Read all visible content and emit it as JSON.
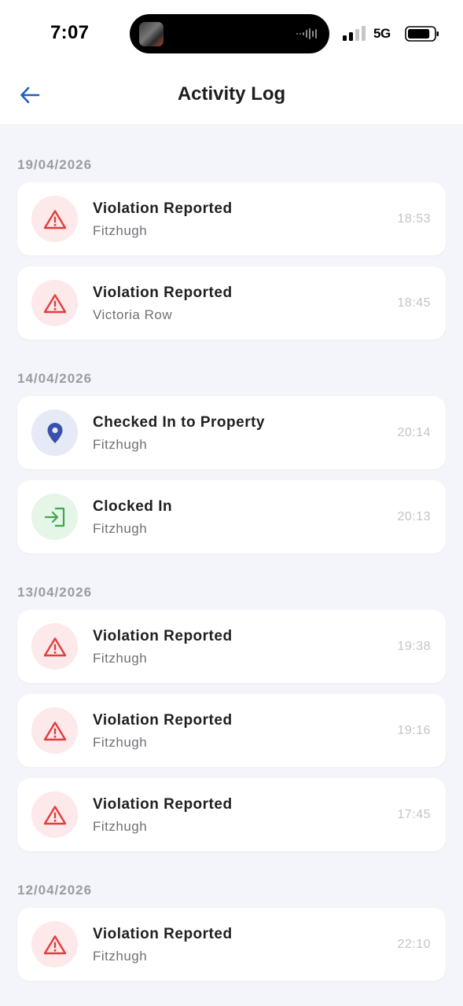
{
  "status_bar": {
    "time": "7:07",
    "network": "5G",
    "signal_bars_filled": 2,
    "signal_bars_total": 4,
    "battery_level": 0.85
  },
  "header": {
    "back_icon": "arrow-left-icon",
    "title": "Activity Log"
  },
  "colors": {
    "accent": "#1f5fbf",
    "violation": "#e23c3c",
    "checkin": "#3b4fad",
    "clockin": "#3fa84e"
  },
  "groups": [
    {
      "date": "19/04/2026",
      "entries": [
        {
          "type": "violation",
          "icon": "warning-icon",
          "title": "Violation Reported",
          "location": "Fitzhugh",
          "time": "18:53"
        },
        {
          "type": "violation",
          "icon": "warning-icon",
          "title": "Violation Reported",
          "location": "Victoria Row",
          "time": "18:45"
        }
      ]
    },
    {
      "date": "14/04/2026",
      "entries": [
        {
          "type": "checkin",
          "icon": "location-pin-icon",
          "title": "Checked In to Property",
          "location": "Fitzhugh",
          "time": "20:14"
        },
        {
          "type": "clockin",
          "icon": "clock-in-icon",
          "title": "Clocked In",
          "location": "Fitzhugh",
          "time": "20:13"
        }
      ]
    },
    {
      "date": "13/04/2026",
      "entries": [
        {
          "type": "violation",
          "icon": "warning-icon",
          "title": "Violation Reported",
          "location": "Fitzhugh",
          "time": "19:38"
        },
        {
          "type": "violation",
          "icon": "warning-icon",
          "title": "Violation Reported",
          "location": "Fitzhugh",
          "time": "19:16"
        },
        {
          "type": "violation",
          "icon": "warning-icon",
          "title": "Violation Reported",
          "location": "Fitzhugh",
          "time": "17:45"
        }
      ]
    },
    {
      "date": "12/04/2026",
      "entries": [
        {
          "type": "violation",
          "icon": "warning-icon",
          "title": "Violation Reported",
          "location": "Fitzhugh",
          "time": "22:10"
        }
      ]
    }
  ]
}
